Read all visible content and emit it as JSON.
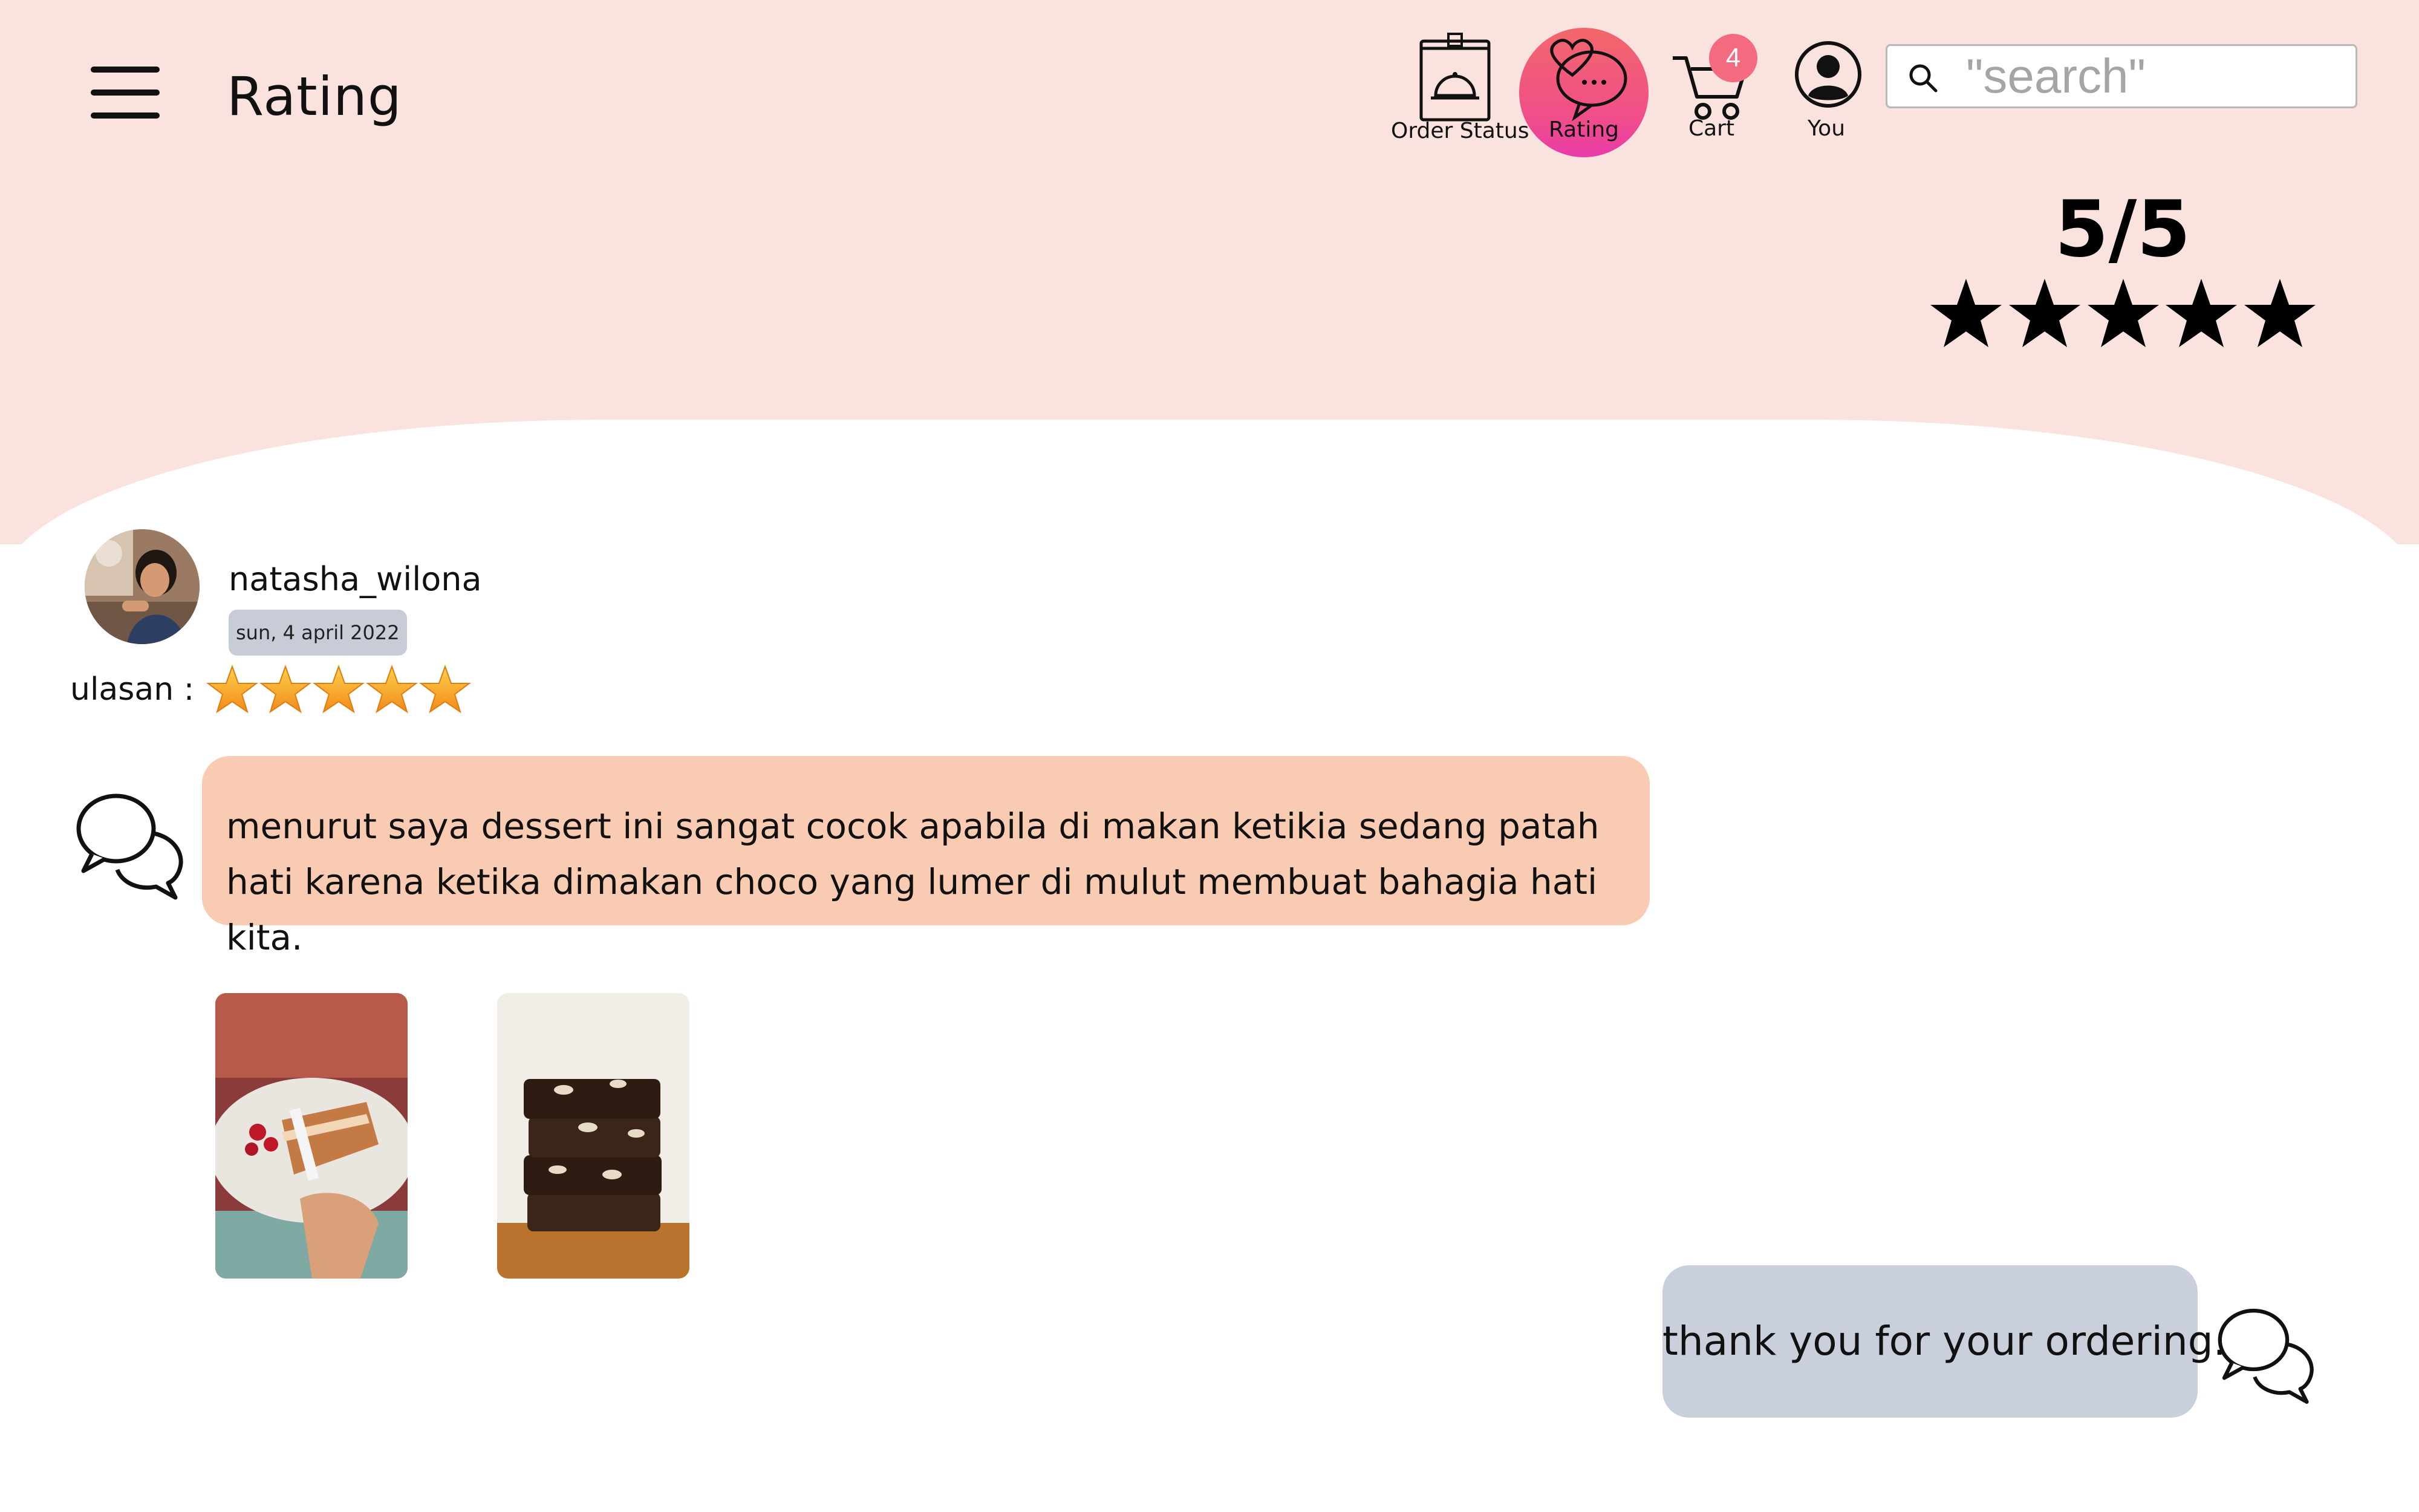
{
  "header": {
    "title": "Rating",
    "nav": [
      {
        "id": "order-status",
        "label": "Order Status",
        "icon": "order-bag-icon"
      },
      {
        "id": "rating",
        "label": "Rating",
        "icon": "heart-chat-icon",
        "active": true
      },
      {
        "id": "cart",
        "label": "Cart",
        "icon": "cart-icon",
        "badge": "4"
      },
      {
        "id": "you",
        "label": "You",
        "icon": "user-circle-icon"
      }
    ],
    "search": {
      "placeholder": "\"search\"",
      "value": ""
    }
  },
  "summary": {
    "score": "5/5",
    "stars": 5
  },
  "review": {
    "username": "natasha_wilona",
    "date": "sun, 4 april 2022",
    "label": "ulasan :",
    "stars": 5,
    "text": "menurut saya dessert ini sangat cocok apabila di makan ketikia sedang patah hati karena ketika dimakan choco yang lumer di mulut membuat bahagia hati kita.",
    "photos": [
      "dessert-cake-photo",
      "brownie-stack-photo"
    ]
  },
  "reply": {
    "text": "thank you for your ordering."
  },
  "colors": {
    "header_bg": "#fae2de",
    "review_bubble": "#f9cbb2",
    "reply_bubble": "#c9d0db",
    "date_badge": "#c7ccd6",
    "cart_badge": "#f46a7f",
    "active_nav_gradient_top": "#f2676a",
    "active_nav_gradient_bottom": "#e93aa9",
    "star_gold": "#f5a623"
  }
}
